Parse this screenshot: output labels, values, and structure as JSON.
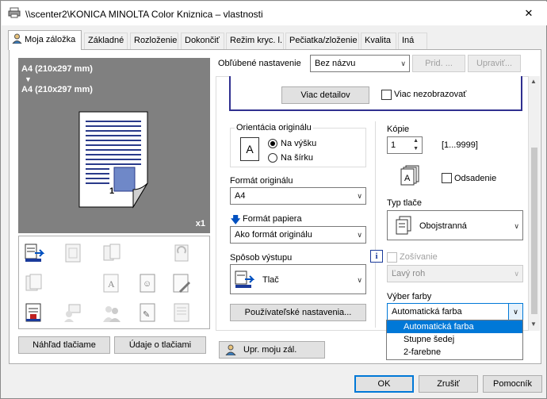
{
  "window": {
    "title": "\\\\scenter2\\KONICA MINOLTA Color Kniznica – vlastnosti",
    "close": "✕"
  },
  "tabs": [
    {
      "label": "Moja záložka",
      "active": true
    },
    {
      "label": "Základné"
    },
    {
      "label": "Rozloženie"
    },
    {
      "label": "Dokončiť"
    },
    {
      "label": "Režim kryc. l."
    },
    {
      "label": "Pečiatka/zloženie"
    },
    {
      "label": "Kvalita"
    },
    {
      "label": "Iná"
    }
  ],
  "preview": {
    "line1": "A4 (210x297 mm)",
    "arrow": "▼",
    "line2": "A4 (210x297 mm)",
    "copies_badge": "x1",
    "page_num": "1"
  },
  "left_buttons": {
    "preview_print": "Náhľad tlačiame",
    "print_info": "Údaje o tlačiami"
  },
  "favorite": {
    "label": "Obľúbené nastavenie",
    "value": "Bez názvu",
    "add": "Prid. ...",
    "edit": "Upraviť..."
  },
  "details": {
    "more_details": "Viac detailov",
    "dont_show": "Viac nezobrazovať"
  },
  "orientation": {
    "group": "Orientácia originálu",
    "portrait": "Na výšku",
    "landscape": "Na šírku",
    "selected": "portrait"
  },
  "original_size": {
    "label": "Formát originálu",
    "value": "A4"
  },
  "paper_size": {
    "label": "Formát papiera",
    "value": "Ako formát originálu"
  },
  "output": {
    "label": "Spôsob výstupu",
    "value": "Tlač"
  },
  "user_settings": "Používateľské nastavenia...",
  "copies": {
    "label": "Kópie",
    "value": "1",
    "range": "[1...9999]"
  },
  "offset": {
    "label": "Odsadenie",
    "checked": false
  },
  "print_type": {
    "label": "Typ tlače",
    "value": "Obojstranná"
  },
  "staple": {
    "label": "Zošívanie",
    "value": "Ľavý roh",
    "info": "i"
  },
  "color": {
    "label": "Výber farby",
    "value": "Automatická farba",
    "options": [
      "Automatická farba",
      "Stupne šedej",
      "2-farebne"
    ],
    "selected_index": 0
  },
  "bottom": {
    "edit_tab": "Upr. moju zál.",
    "ok": "OK",
    "cancel": "Zrušiť",
    "help": "Pomocník"
  },
  "colors": {
    "accent": "#0078d7",
    "highlight": "#0078d7"
  }
}
